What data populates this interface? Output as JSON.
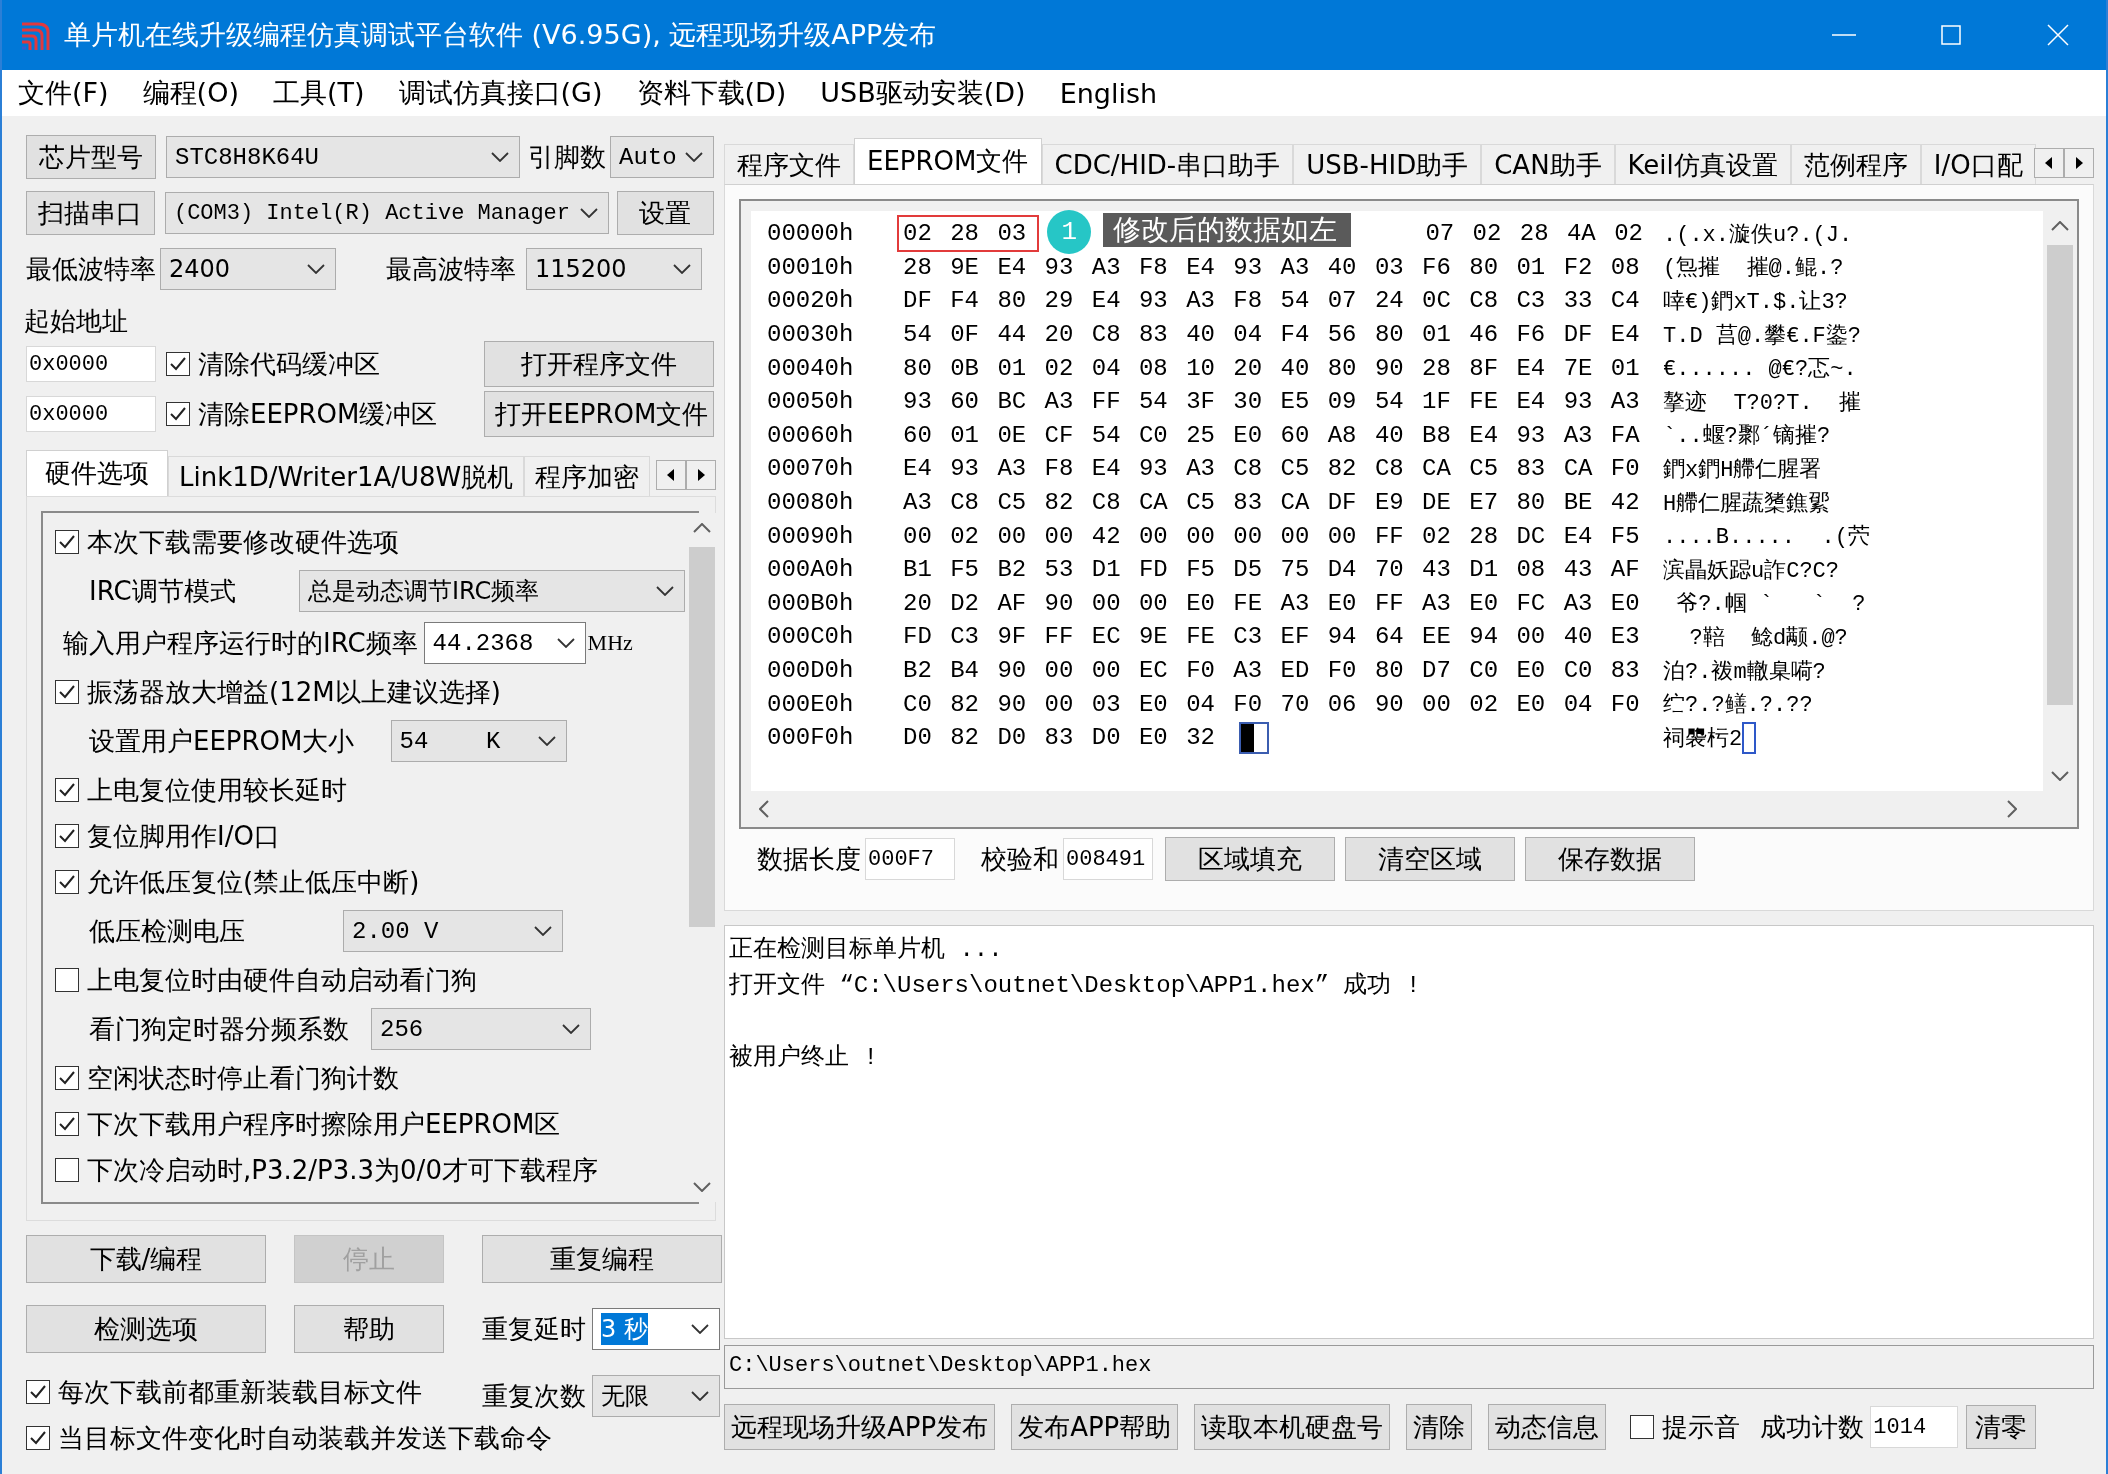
{
  "window": {
    "title": "单片机在线升级编程仿真调试平台软件 (V6.95G), 远程现场升级APP发布"
  },
  "menu": [
    "文件(F)",
    "编程(O)",
    "工具(T)",
    "调试仿真接口(G)",
    "资料下载(D)",
    "USB驱动安装(D)",
    "English"
  ],
  "chip": {
    "button": "芯片型号",
    "value": "STC8H8K64U",
    "pins_label": "引脚数",
    "pins": "Auto"
  },
  "port": {
    "button": "扫描串口",
    "value": "(COM3) Intel(R) Active Manager",
    "settings": "设置"
  },
  "baud": {
    "min_label": "最低波特率",
    "min": "2400",
    "max_label": "最高波特率",
    "max": "115200"
  },
  "start_address": {
    "label": "起始地址",
    "rows": [
      {
        "value": "0x0000",
        "check_label": "清除代码缓冲区",
        "checked": true,
        "button": "打开程序文件"
      },
      {
        "value": "0x0000",
        "check_label": "清除EEPROM缓冲区",
        "checked": true,
        "button": "打开EEPROM文件"
      }
    ]
  },
  "option_tabs": [
    {
      "label": "硬件选项",
      "selected": true
    },
    {
      "label": "Link1D/Writer1A/U8W脱机",
      "selected": false
    },
    {
      "label": "程序加密",
      "selected": false
    }
  ],
  "hardware_options": [
    {
      "kind": "checkbox",
      "label": "本次下载需要修改硬件选项",
      "checked": true
    },
    {
      "kind": "select",
      "label": "IRC调节模式",
      "value": "总是动态调节IRC频率"
    },
    {
      "kind": "entry",
      "label": "输入用户程序运行时的IRC频率",
      "value": "44.2368",
      "unit": "MHz"
    },
    {
      "kind": "checkbox",
      "label": "振荡器放大增益(12M以上建议选择)",
      "checked": true
    },
    {
      "kind": "select",
      "label": "设置用户EEPROM大小",
      "value": "54    K"
    },
    {
      "kind": "checkbox",
      "label": "上电复位使用较长延时",
      "checked": true
    },
    {
      "kind": "checkbox",
      "label": "复位脚用作I/O口",
      "checked": true
    },
    {
      "kind": "checkbox",
      "label": "允许低压复位(禁止低压中断)",
      "checked": true
    },
    {
      "kind": "select",
      "label": "低压检测电压",
      "value": "2.00 V"
    },
    {
      "kind": "checkbox",
      "label": "上电复位时由硬件自动启动看门狗",
      "checked": false
    },
    {
      "kind": "select",
      "label": "看门狗定时器分频系数",
      "value": "256"
    },
    {
      "kind": "checkbox",
      "label": "空闲状态时停止看门狗计数",
      "checked": true
    },
    {
      "kind": "checkbox",
      "label": "下次下载用户程序时擦除用户EEPROM区",
      "checked": true
    },
    {
      "kind": "checkbox",
      "label": "下次冷启动时,P3.2/P3.3为0/0才可下载程序",
      "checked": false
    }
  ],
  "actions": {
    "download": {
      "label": "下载/编程",
      "disabled": false
    },
    "stop": {
      "label": "停止",
      "disabled": true
    },
    "repeat": {
      "label": "重复编程",
      "disabled": false
    },
    "detect": {
      "label": "检测选项",
      "disabled": false
    },
    "help": {
      "label": "帮助",
      "disabled": false
    },
    "repeat_delay": {
      "label": "重复延时",
      "value": "3 秒",
      "highlighted": true
    },
    "repeat_count": {
      "label": "重复次数",
      "value": "无限",
      "highlighted": false
    }
  },
  "auto_options": [
    {
      "label": "每次下载前都重新装载目标文件",
      "checked": true
    },
    {
      "label": "当目标文件变化时自动装载并发送下载命令",
      "checked": true
    }
  ],
  "main_tabs": [
    {
      "label": "程序文件",
      "selected": false
    },
    {
      "label": "EEPROM文件",
      "selected": true
    },
    {
      "label": "CDC/HID-串口助手",
      "selected": false
    },
    {
      "label": "USB-HID助手",
      "selected": false
    },
    {
      "label": "CAN助手",
      "selected": false
    },
    {
      "label": "Keil仿真设置",
      "selected": false
    },
    {
      "label": "范例程序",
      "selected": false
    },
    {
      "label": "I/O口配",
      "selected": false
    }
  ],
  "hex_view": {
    "callout": {
      "number": "1",
      "text": "修改后的数据如左"
    },
    "rows": [
      {
        "address": "00000h",
        "marked": [
          "02",
          "28",
          "03"
        ],
        "bytes": [
          "07",
          "02",
          "28",
          "4A",
          "02"
        ],
        "text": ".(.x.漩佚u?.(J."
      },
      {
        "address": "00010h",
        "bytes": [
          "28",
          "9E",
          "E4",
          "93",
          "A3",
          "F8",
          "E4",
          "93",
          "A3",
          "40",
          "03",
          "F6",
          "80",
          "01",
          "F2",
          "08"
        ],
        "text": "(炰摧  摧@.鲲.?"
      },
      {
        "address": "00020h",
        "bytes": [
          "DF",
          "F4",
          "80",
          "29",
          "E4",
          "93",
          "A3",
          "F8",
          "54",
          "07",
          "24",
          "0C",
          "C8",
          "C3",
          "33",
          "C4"
        ],
        "text": "啈€)鍆xT.$.让3?"
      },
      {
        "address": "00030h",
        "bytes": [
          "54",
          "0F",
          "44",
          "20",
          "C8",
          "83",
          "40",
          "04",
          "F4",
          "56",
          "80",
          "01",
          "46",
          "F6",
          "DF",
          "E4"
        ],
        "text": "T.D 莒@.攀€.F鍌?"
      },
      {
        "address": "00040h",
        "bytes": [
          "80",
          "0B",
          "01",
          "02",
          "04",
          "08",
          "10",
          "20",
          "40",
          "80",
          "90",
          "28",
          "8F",
          "E4",
          "7E",
          "01"
        ],
        "text": "€...... @€?忑~."
      },
      {
        "address": "00050h",
        "bytes": [
          "93",
          "60",
          "BC",
          "A3",
          "FF",
          "54",
          "3F",
          "30",
          "E5",
          "09",
          "54",
          "1F",
          "FE",
          "E4",
          "93",
          "A3"
        ],
        "text": "摮迹  T?0?T.  摧"
      },
      {
        "address": "00060h",
        "bytes": [
          "60",
          "01",
          "0E",
          "CF",
          "54",
          "C0",
          "25",
          "E0",
          "60",
          "A8",
          "40",
          "B8",
          "E4",
          "93",
          "A3",
          "FA"
        ],
        "text": "`..蝘?鄹´镝摧?"
      },
      {
        "address": "00070h",
        "bytes": [
          "E4",
          "93",
          "A3",
          "F8",
          "E4",
          "93",
          "A3",
          "C8",
          "C5",
          "82",
          "C8",
          "CA",
          "C5",
          "83",
          "CA",
          "F0"
        ],
        "text": "鍆x鍆H艜仁腥署"
      },
      {
        "address": "00080h",
        "bytes": [
          "A3",
          "C8",
          "C5",
          "82",
          "C8",
          "CA",
          "C5",
          "83",
          "CA",
          "DF",
          "E9",
          "DE",
          "E7",
          "80",
          "BE",
          "42"
        ],
        "text": "H艜仁腥蔬橥鐎綤"
      },
      {
        "address": "00090h",
        "bytes": [
          "00",
          "02",
          "00",
          "00",
          "42",
          "00",
          "00",
          "00",
          "00",
          "00",
          "FF",
          "02",
          "28",
          "DC",
          "E4",
          "F5"
        ],
        "text": "....B.....  .(茓"
      },
      {
        "address": "000A0h",
        "bytes": [
          "B1",
          "F5",
          "B2",
          "53",
          "D1",
          "FD",
          "F5",
          "D5",
          "75",
          "D4",
          "70",
          "43",
          "D1",
          "08",
          "43",
          "AF"
        ],
        "text": "滨瞐妖跽u詐C?C?"
      },
      {
        "address": "000B0h",
        "bytes": [
          "20",
          "D2",
          "AF",
          "90",
          "00",
          "00",
          "E0",
          "FE",
          "A3",
          "E0",
          "FF",
          "A3",
          "E0",
          "FC",
          "A3",
          "E0"
        ],
        "text": " 爷?.帼 `   `  ?"
      },
      {
        "address": "000C0h",
        "bytes": [
          "FD",
          "C3",
          "9F",
          "FF",
          "EC",
          "9E",
          "FE",
          "C3",
          "EF",
          "94",
          "64",
          "EE",
          "94",
          "00",
          "40",
          "E3"
        ],
        "text": "  ?鞛  鲶d颟.@?"
      },
      {
        "address": "000D0h",
        "bytes": [
          "B2",
          "B4",
          "90",
          "00",
          "00",
          "EC",
          "F0",
          "A3",
          "ED",
          "F0",
          "80",
          "D7",
          "C0",
          "E0",
          "C0",
          "83"
        ],
        "text": "泊?.袯m轍臬嗬?"
      },
      {
        "address": "000E0h",
        "bytes": [
          "C0",
          "82",
          "90",
          "00",
          "03",
          "E0",
          "04",
          "F0",
          "70",
          "06",
          "90",
          "00",
          "02",
          "E0",
          "04",
          "F0"
        ],
        "text": "纻?.?鳝.?.??"
      },
      {
        "address": "000F0h",
        "bytes": [
          "D0",
          "82",
          "D0",
          "83",
          "D0",
          "E0",
          "32"
        ],
        "text": "祠褜杇2"
      }
    ]
  },
  "hex_footer": {
    "length_label": "数据长度",
    "length": "000F7",
    "checksum_label": "校验和",
    "checksum": "008491",
    "buttons": [
      "区域填充",
      "清空区域",
      "保存数据"
    ]
  },
  "log": [
    {
      "text": "正在检测目标单片机 ...",
      "gap_before": false
    },
    {
      "text": "打开文件 “C:\\Users\\outnet\\Desktop\\APP1.hex” 成功 !",
      "gap_before": false
    },
    {
      "text": "被用户终止 !",
      "gap_before": true
    }
  ],
  "path": "C:\\Users\\outnet\\Desktop\\APP1.hex",
  "bottom_bar": {
    "buttons": [
      "远程现场升级APP发布",
      "发布APP帮助",
      "读取本机硬盘号",
      "清除",
      "动态信息"
    ],
    "sound": {
      "label": "提示音",
      "checked": false
    },
    "count_label": "成功计数",
    "count": "1014",
    "reset": "清零"
  }
}
